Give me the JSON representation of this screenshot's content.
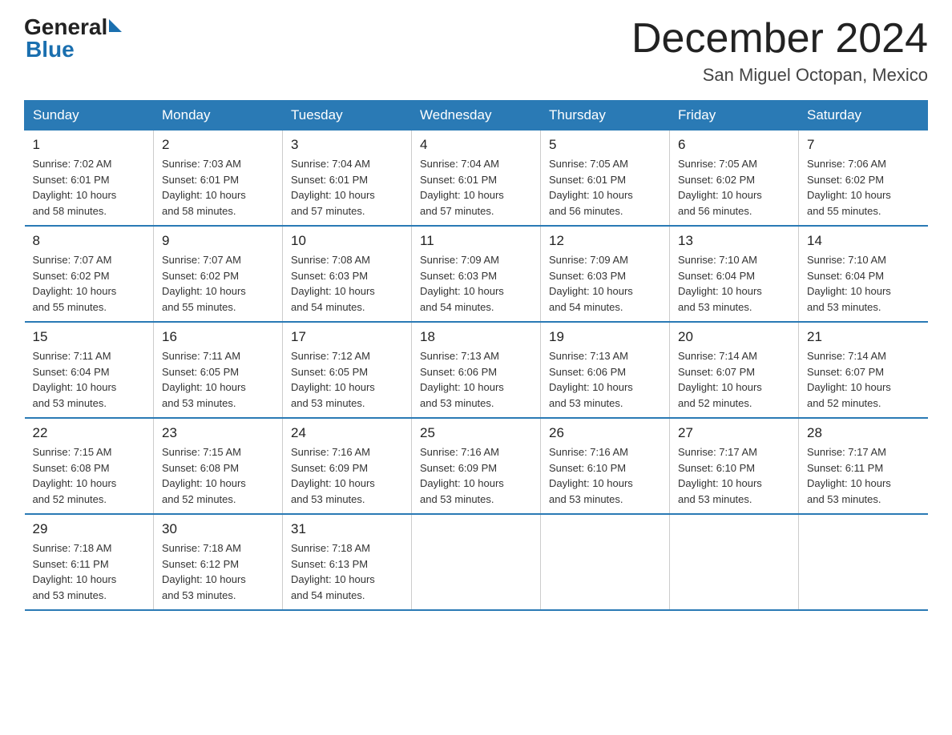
{
  "logo": {
    "general": "General",
    "blue": "Blue"
  },
  "title": "December 2024",
  "location": "San Miguel Octopan, Mexico",
  "days_of_week": [
    "Sunday",
    "Monday",
    "Tuesday",
    "Wednesday",
    "Thursday",
    "Friday",
    "Saturday"
  ],
  "weeks": [
    [
      {
        "day": "1",
        "info": "Sunrise: 7:02 AM\nSunset: 6:01 PM\nDaylight: 10 hours\nand 58 minutes."
      },
      {
        "day": "2",
        "info": "Sunrise: 7:03 AM\nSunset: 6:01 PM\nDaylight: 10 hours\nand 58 minutes."
      },
      {
        "day": "3",
        "info": "Sunrise: 7:04 AM\nSunset: 6:01 PM\nDaylight: 10 hours\nand 57 minutes."
      },
      {
        "day": "4",
        "info": "Sunrise: 7:04 AM\nSunset: 6:01 PM\nDaylight: 10 hours\nand 57 minutes."
      },
      {
        "day": "5",
        "info": "Sunrise: 7:05 AM\nSunset: 6:01 PM\nDaylight: 10 hours\nand 56 minutes."
      },
      {
        "day": "6",
        "info": "Sunrise: 7:05 AM\nSunset: 6:02 PM\nDaylight: 10 hours\nand 56 minutes."
      },
      {
        "day": "7",
        "info": "Sunrise: 7:06 AM\nSunset: 6:02 PM\nDaylight: 10 hours\nand 55 minutes."
      }
    ],
    [
      {
        "day": "8",
        "info": "Sunrise: 7:07 AM\nSunset: 6:02 PM\nDaylight: 10 hours\nand 55 minutes."
      },
      {
        "day": "9",
        "info": "Sunrise: 7:07 AM\nSunset: 6:02 PM\nDaylight: 10 hours\nand 55 minutes."
      },
      {
        "day": "10",
        "info": "Sunrise: 7:08 AM\nSunset: 6:03 PM\nDaylight: 10 hours\nand 54 minutes."
      },
      {
        "day": "11",
        "info": "Sunrise: 7:09 AM\nSunset: 6:03 PM\nDaylight: 10 hours\nand 54 minutes."
      },
      {
        "day": "12",
        "info": "Sunrise: 7:09 AM\nSunset: 6:03 PM\nDaylight: 10 hours\nand 54 minutes."
      },
      {
        "day": "13",
        "info": "Sunrise: 7:10 AM\nSunset: 6:04 PM\nDaylight: 10 hours\nand 53 minutes."
      },
      {
        "day": "14",
        "info": "Sunrise: 7:10 AM\nSunset: 6:04 PM\nDaylight: 10 hours\nand 53 minutes."
      }
    ],
    [
      {
        "day": "15",
        "info": "Sunrise: 7:11 AM\nSunset: 6:04 PM\nDaylight: 10 hours\nand 53 minutes."
      },
      {
        "day": "16",
        "info": "Sunrise: 7:11 AM\nSunset: 6:05 PM\nDaylight: 10 hours\nand 53 minutes."
      },
      {
        "day": "17",
        "info": "Sunrise: 7:12 AM\nSunset: 6:05 PM\nDaylight: 10 hours\nand 53 minutes."
      },
      {
        "day": "18",
        "info": "Sunrise: 7:13 AM\nSunset: 6:06 PM\nDaylight: 10 hours\nand 53 minutes."
      },
      {
        "day": "19",
        "info": "Sunrise: 7:13 AM\nSunset: 6:06 PM\nDaylight: 10 hours\nand 53 minutes."
      },
      {
        "day": "20",
        "info": "Sunrise: 7:14 AM\nSunset: 6:07 PM\nDaylight: 10 hours\nand 52 minutes."
      },
      {
        "day": "21",
        "info": "Sunrise: 7:14 AM\nSunset: 6:07 PM\nDaylight: 10 hours\nand 52 minutes."
      }
    ],
    [
      {
        "day": "22",
        "info": "Sunrise: 7:15 AM\nSunset: 6:08 PM\nDaylight: 10 hours\nand 52 minutes."
      },
      {
        "day": "23",
        "info": "Sunrise: 7:15 AM\nSunset: 6:08 PM\nDaylight: 10 hours\nand 52 minutes."
      },
      {
        "day": "24",
        "info": "Sunrise: 7:16 AM\nSunset: 6:09 PM\nDaylight: 10 hours\nand 53 minutes."
      },
      {
        "day": "25",
        "info": "Sunrise: 7:16 AM\nSunset: 6:09 PM\nDaylight: 10 hours\nand 53 minutes."
      },
      {
        "day": "26",
        "info": "Sunrise: 7:16 AM\nSunset: 6:10 PM\nDaylight: 10 hours\nand 53 minutes."
      },
      {
        "day": "27",
        "info": "Sunrise: 7:17 AM\nSunset: 6:10 PM\nDaylight: 10 hours\nand 53 minutes."
      },
      {
        "day": "28",
        "info": "Sunrise: 7:17 AM\nSunset: 6:11 PM\nDaylight: 10 hours\nand 53 minutes."
      }
    ],
    [
      {
        "day": "29",
        "info": "Sunrise: 7:18 AM\nSunset: 6:11 PM\nDaylight: 10 hours\nand 53 minutes."
      },
      {
        "day": "30",
        "info": "Sunrise: 7:18 AM\nSunset: 6:12 PM\nDaylight: 10 hours\nand 53 minutes."
      },
      {
        "day": "31",
        "info": "Sunrise: 7:18 AM\nSunset: 6:13 PM\nDaylight: 10 hours\nand 54 minutes."
      },
      {
        "day": "",
        "info": ""
      },
      {
        "day": "",
        "info": ""
      },
      {
        "day": "",
        "info": ""
      },
      {
        "day": "",
        "info": ""
      }
    ]
  ]
}
